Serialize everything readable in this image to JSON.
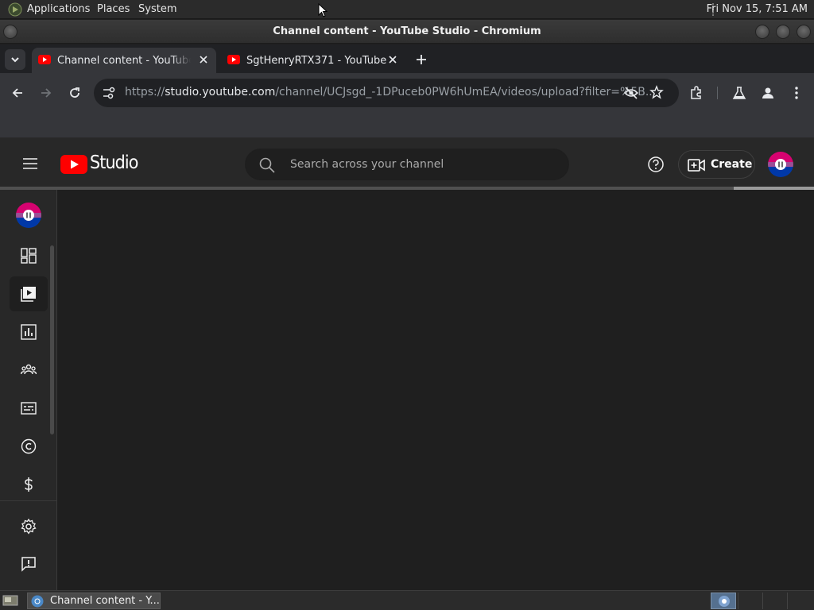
{
  "top_panel": {
    "menus": [
      "Applications",
      "Places",
      "System"
    ],
    "clock": "Fri Nov 15,  7:51 AM"
  },
  "window": {
    "title": "Channel content - YouTube Studio - Chromium"
  },
  "tabs": [
    {
      "label": "Channel content - YouTube Studio",
      "active": true
    },
    {
      "label": "SgtHenryRTX371 - YouTube",
      "active": false
    }
  ],
  "address_bar": {
    "scheme": "https://",
    "host": "studio.youtube.com",
    "path": "/channel/UCJsgd_-1DPuceb0PW6hUmEA/videos/upload?filter=%5B..."
  },
  "studio": {
    "logo_text": "Studio",
    "search_placeholder": "Search across your channel",
    "create_label": "Create",
    "nav_items": [
      {
        "name": "dashboard",
        "icon": "dashboard-icon",
        "selected": false
      },
      {
        "name": "content",
        "icon": "content-icon",
        "selected": true
      },
      {
        "name": "analytics",
        "icon": "analytics-icon",
        "selected": false
      },
      {
        "name": "community",
        "icon": "community-icon",
        "selected": false
      },
      {
        "name": "subtitles",
        "icon": "subtitles-icon",
        "selected": false
      },
      {
        "name": "copyright",
        "icon": "copyright-icon",
        "selected": false
      },
      {
        "name": "earn",
        "icon": "dollar-icon",
        "selected": false
      },
      {
        "name": "settings",
        "icon": "gear-icon",
        "selected": false
      },
      {
        "name": "send-feedback",
        "icon": "feedback-icon",
        "selected": false
      }
    ]
  },
  "taskbar": {
    "task_label": "Channel content - Y..."
  },
  "colors": {
    "youtube_red": "#ff0000",
    "background": "#1f1f1f",
    "header": "#282828"
  }
}
